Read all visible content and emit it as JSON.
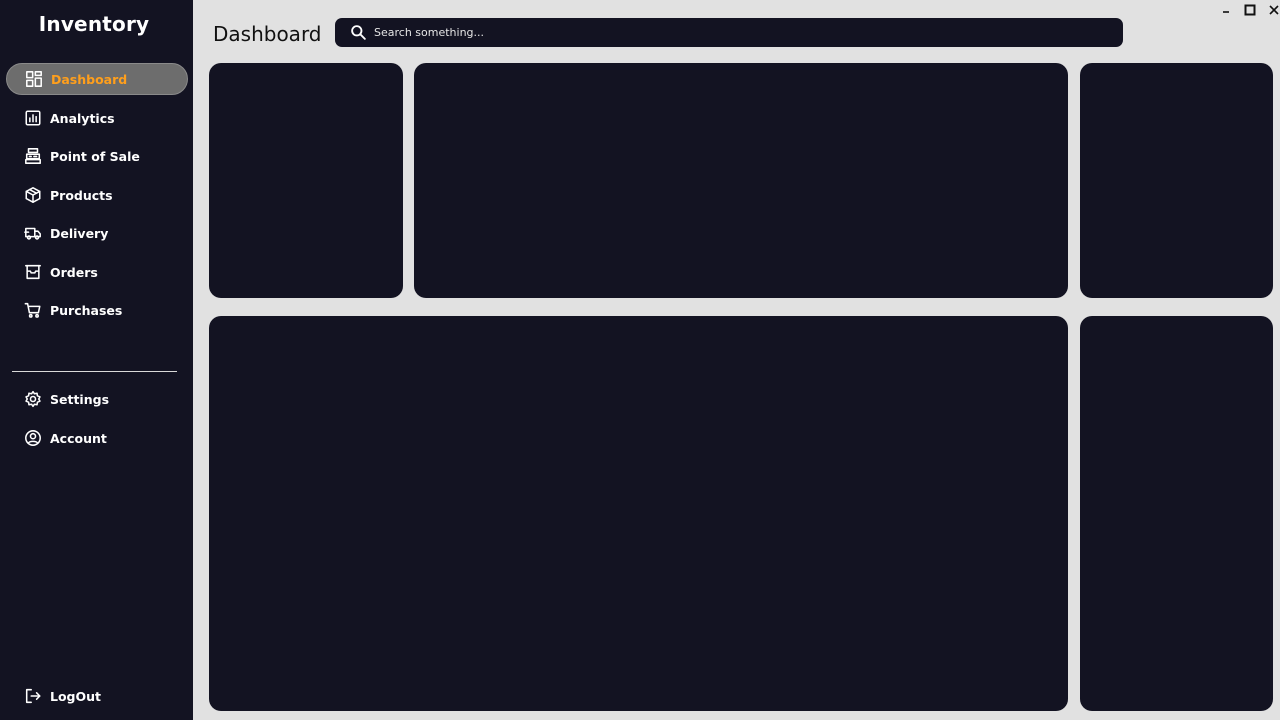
{
  "app": {
    "brand": "Inventory",
    "page_title": "Dashboard"
  },
  "colors": {
    "sidebar_bg": "#131322",
    "page_bg": "#e1e1e1",
    "card_bg": "#131322",
    "active_text": "#ff9f1c",
    "active_bg": "#6d6d6d"
  },
  "search": {
    "placeholder": "Search something...",
    "value": ""
  },
  "sidebar": {
    "items": [
      {
        "label": "Dashboard",
        "icon": "dashboard-grid-icon",
        "active": true
      },
      {
        "label": "Analytics",
        "icon": "analytics-chart-icon",
        "active": false
      },
      {
        "label": "Point of Sale",
        "icon": "cash-register-icon",
        "active": false
      },
      {
        "label": "Products",
        "icon": "package-box-icon",
        "active": false
      },
      {
        "label": "Delivery",
        "icon": "delivery-truck-icon",
        "active": false
      },
      {
        "label": "Orders",
        "icon": "orders-tray-icon",
        "active": false
      },
      {
        "label": "Purchases",
        "icon": "shopping-cart-icon",
        "active": false
      }
    ],
    "bottom_items": [
      {
        "label": "Settings",
        "icon": "gear-icon"
      },
      {
        "label": "Account",
        "icon": "user-circle-icon"
      }
    ],
    "logout": {
      "label": "LogOut",
      "icon": "logout-icon"
    }
  },
  "window_controls": [
    "minimize-icon",
    "maximize-icon",
    "close-icon"
  ]
}
